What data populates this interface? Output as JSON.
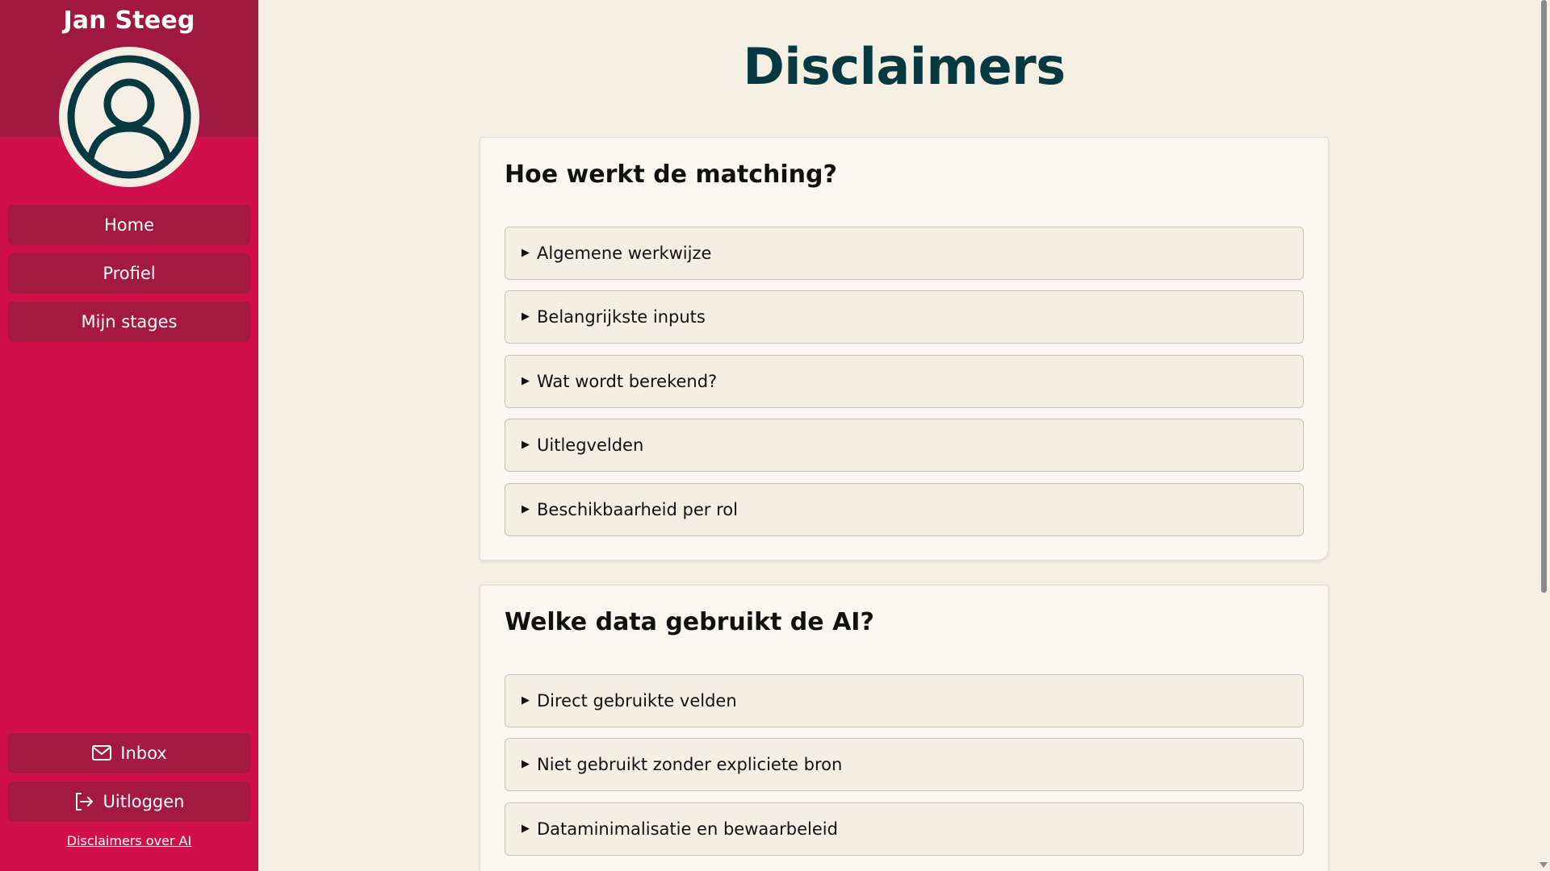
{
  "sidebar": {
    "user_name": "Jan Steeg",
    "avatar_icon": "user-circle-icon",
    "nav": [
      {
        "label": "Home"
      },
      {
        "label": "Profiel"
      },
      {
        "label": "Mijn stages"
      }
    ],
    "inbox": {
      "label": "Inbox",
      "icon": "mail-icon"
    },
    "logout": {
      "label": "Uitloggen",
      "icon": "logout-icon"
    },
    "disclaimer_link": "Disclaimers over AI"
  },
  "main": {
    "title": "Disclaimers",
    "sections": [
      {
        "heading": "Hoe werkt de matching?",
        "items": [
          {
            "label": "Algemene werkwijze"
          },
          {
            "label": "Belangrijkste inputs"
          },
          {
            "label": "Wat wordt berekend?"
          },
          {
            "label": "Uitlegvelden"
          },
          {
            "label": "Beschikbaarheid per rol"
          }
        ]
      },
      {
        "heading": "Welke data gebruikt de AI?",
        "items": [
          {
            "label": "Direct gebruikte velden"
          },
          {
            "label": "Niet gebruikt zonder expliciete bron"
          },
          {
            "label": "Dataminimalisatie en bewaarbeleid"
          }
        ]
      }
    ]
  },
  "colors": {
    "sidebar": "#d10f4c",
    "sidebar_header": "#a0183f",
    "nav_button": "#a3193f",
    "title": "#063a40",
    "page_bg": "#f6efe4"
  }
}
